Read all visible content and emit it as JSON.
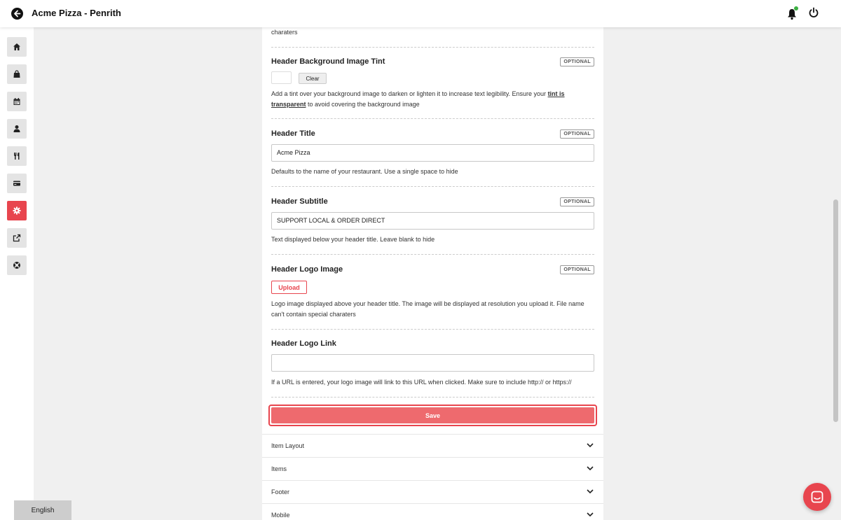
{
  "header": {
    "title": "Acme Pizza - Penrith"
  },
  "sidebar": {
    "items": [
      {
        "name": "home-icon"
      },
      {
        "name": "shopping-bag-icon"
      },
      {
        "name": "calendar-icon"
      },
      {
        "name": "user-icon"
      },
      {
        "name": "utensils-icon"
      },
      {
        "name": "credit-card-icon"
      },
      {
        "name": "gear-icon",
        "active": true
      },
      {
        "name": "external-link-icon"
      },
      {
        "name": "lifebuoy-icon"
      }
    ]
  },
  "language": "English",
  "form": {
    "optional_label": "OPTIONAL",
    "top_help_tail": "charaters",
    "tint": {
      "label": "Header Background Image Tint",
      "clear": "Clear",
      "help_before": "Add a tint over your background image to darken or lighten it to increase text legibility. Ensure your",
      "help_link": "tint is transparent",
      "help_after": "to avoid covering the background image"
    },
    "title": {
      "label": "Header Title",
      "value": "Acme Pizza",
      "help": "Defaults to the name of your restaurant. Use a single space to hide"
    },
    "subtitle": {
      "label": "Header Subtitle",
      "value": "SUPPORT LOCAL & ORDER DIRECT",
      "help": "Text displayed below your header title. Leave blank to hide"
    },
    "logo_image": {
      "label": "Header Logo Image",
      "upload": "Upload",
      "help": "Logo image displayed above your header title. The image will be displayed at resolution you upload it. File name can't contain special charaters"
    },
    "logo_link": {
      "label": "Header Logo Link",
      "value": "",
      "help": "If a URL is entered, your logo image will link to this URL when clicked. Make sure to include http:// or https://"
    },
    "save": "Save"
  },
  "sections": [
    "Item Layout",
    "Items",
    "Footer",
    "Mobile"
  ],
  "colors": {
    "accent": "#e8454e",
    "save_fill": "#ee6a6e",
    "notification_dot": "#3cb043"
  }
}
